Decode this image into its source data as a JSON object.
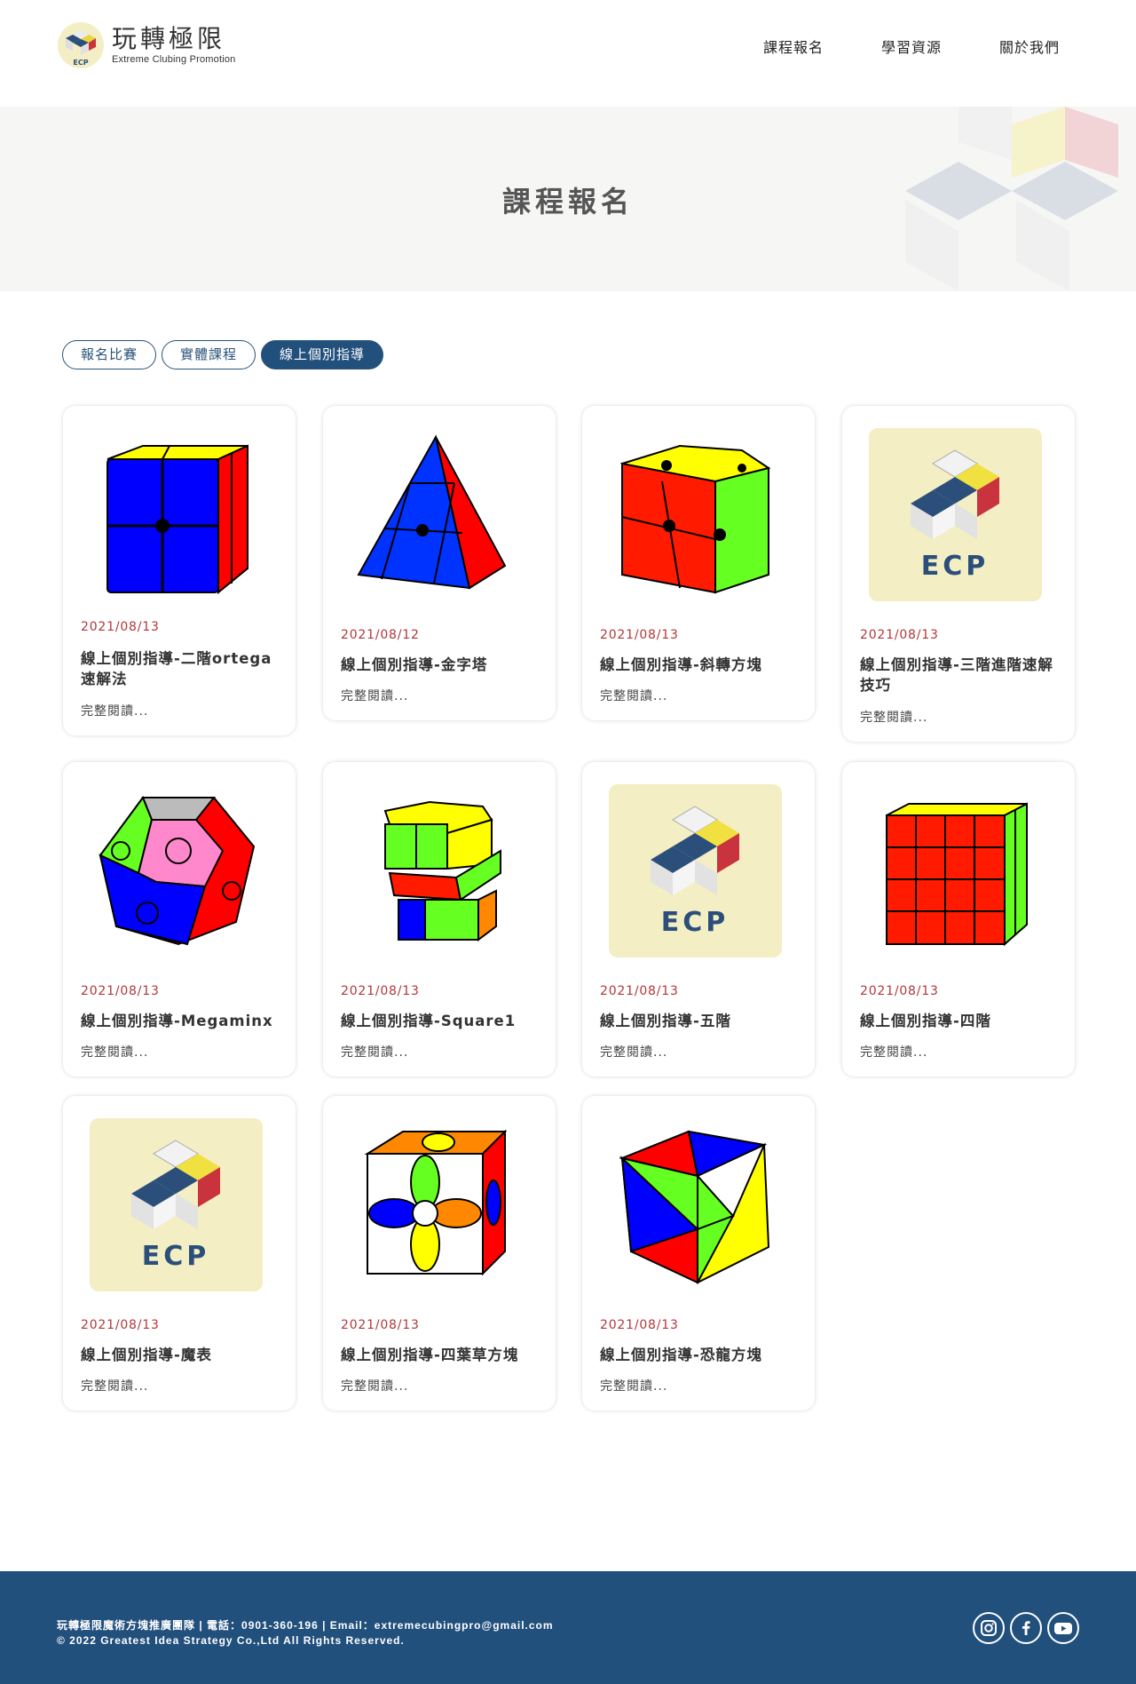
{
  "header": {
    "logo_title": "玩轉極限",
    "logo_subtitle": "Extreme Clubing Promotion",
    "logo_badge": "ECP",
    "nav": [
      "課程報名",
      "學習資源",
      "關於我們"
    ]
  },
  "banner": {
    "title": "課程報名"
  },
  "tabs": [
    {
      "label": "報名比賽",
      "active": false
    },
    {
      "label": "實體課程",
      "active": false
    },
    {
      "label": "線上個別指導",
      "active": true
    }
  ],
  "cards": [
    {
      "date": "2021/08/13",
      "title": "線上個別指導-二階ortega速解法",
      "more": "完整閱讀...",
      "icon": "2x2-cube-icon"
    },
    {
      "date": "2021/08/12",
      "title": "線上個別指導-金字塔",
      "more": "完整閱讀...",
      "icon": "pyraminx-icon"
    },
    {
      "date": "2021/08/13",
      "title": "線上個別指導-斜轉方塊",
      "more": "完整閱讀...",
      "icon": "skewb-icon"
    },
    {
      "date": "2021/08/13",
      "title": "線上個別指導-三階進階速解技巧",
      "more": "完整閱讀...",
      "icon": "ecp-logo-icon"
    },
    {
      "date": "2021/08/13",
      "title": "線上個別指導-Megaminx",
      "more": "完整閱讀...",
      "icon": "megaminx-icon"
    },
    {
      "date": "2021/08/13",
      "title": "線上個別指導-Square1",
      "more": "完整閱讀...",
      "icon": "square1-icon"
    },
    {
      "date": "2021/08/13",
      "title": "線上個別指導-五階",
      "more": "完整閱讀...",
      "icon": "ecp-logo-icon"
    },
    {
      "date": "2021/08/13",
      "title": "線上個別指導-四階",
      "more": "完整閱讀...",
      "icon": "4x4-cube-icon"
    },
    {
      "date": "2021/08/13",
      "title": "線上個別指導-魔表",
      "more": "完整閱讀...",
      "icon": "ecp-logo-icon"
    },
    {
      "date": "2021/08/13",
      "title": "線上個別指導-四葉草方塊",
      "more": "完整閱讀...",
      "icon": "clover-cube-icon"
    },
    {
      "date": "2021/08/13",
      "title": "線上個別指導-恐龍方塊",
      "more": "完整閱讀...",
      "icon": "dino-cube-icon"
    }
  ],
  "footer": {
    "contact": "玩轉極限魔術方塊推廣團隊 | 電話：0901-360-196 | Email：extremecubingpro@gmail.com",
    "copyright": "© 2022 Greatest Idea Strategy Co.,Ltd All Rights Reserved.",
    "social": [
      "instagram-icon",
      "facebook-icon",
      "youtube-icon"
    ]
  },
  "colors": {
    "primary": "#22507c",
    "date": "#b0383a",
    "banner_bg": "#f6f6f5",
    "ecp_bg": "#f3eec4"
  }
}
